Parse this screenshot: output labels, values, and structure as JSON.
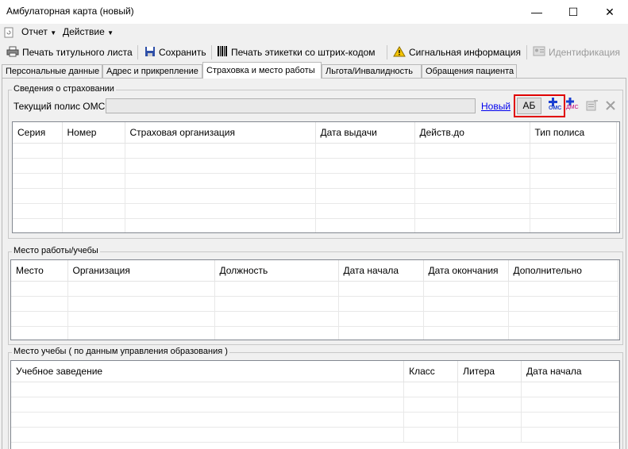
{
  "window": {
    "title": "Амбулаторная карта (новый)",
    "minimize_glyph": "—",
    "maximize_glyph": "☐",
    "close_glyph": "✕"
  },
  "menu": {
    "report": "Отчет",
    "action": "Действие"
  },
  "toolbar": {
    "print_title": "Печать титульного листа",
    "save": "Сохранить",
    "print_barcode": "Печать этикетки со штрих-кодом",
    "signal_info": "Сигнальная информация",
    "identification": "Идентификация"
  },
  "tabs": [
    {
      "label": "Персональные данные"
    },
    {
      "label": "Адрес и прикрепление"
    },
    {
      "label": "Страховка и место работы"
    },
    {
      "label": "Льгота/Инвалидность"
    },
    {
      "label": "Обращения пациента"
    }
  ],
  "insurance": {
    "group_title": "Сведения о страховании",
    "current_policy_label": "Текущий полис ОМС",
    "current_policy_value": "",
    "new_link": "Новый",
    "ab_button": "АБ",
    "oms_label": "ОМС",
    "dms_label": "ДМС",
    "columns": [
      "Серия",
      "Номер",
      "Страховая организация",
      "Дата выдачи",
      "Действ.до",
      "Тип полиса"
    ]
  },
  "work": {
    "group_title": "Место работы/учебы",
    "columns": [
      "Место",
      "Организация",
      "Должность",
      "Дата начала",
      "Дата окончания",
      "Дополнительно"
    ]
  },
  "study": {
    "group_title": "Место учебы ( по данным управления образования )",
    "columns": [
      "Учебное заведение",
      "Класс",
      "Литера",
      "Дата начала"
    ]
  },
  "colors": {
    "highlight_border": "#e00000",
    "link": "#0000ee",
    "plus_blue": "#1a3fd1"
  }
}
